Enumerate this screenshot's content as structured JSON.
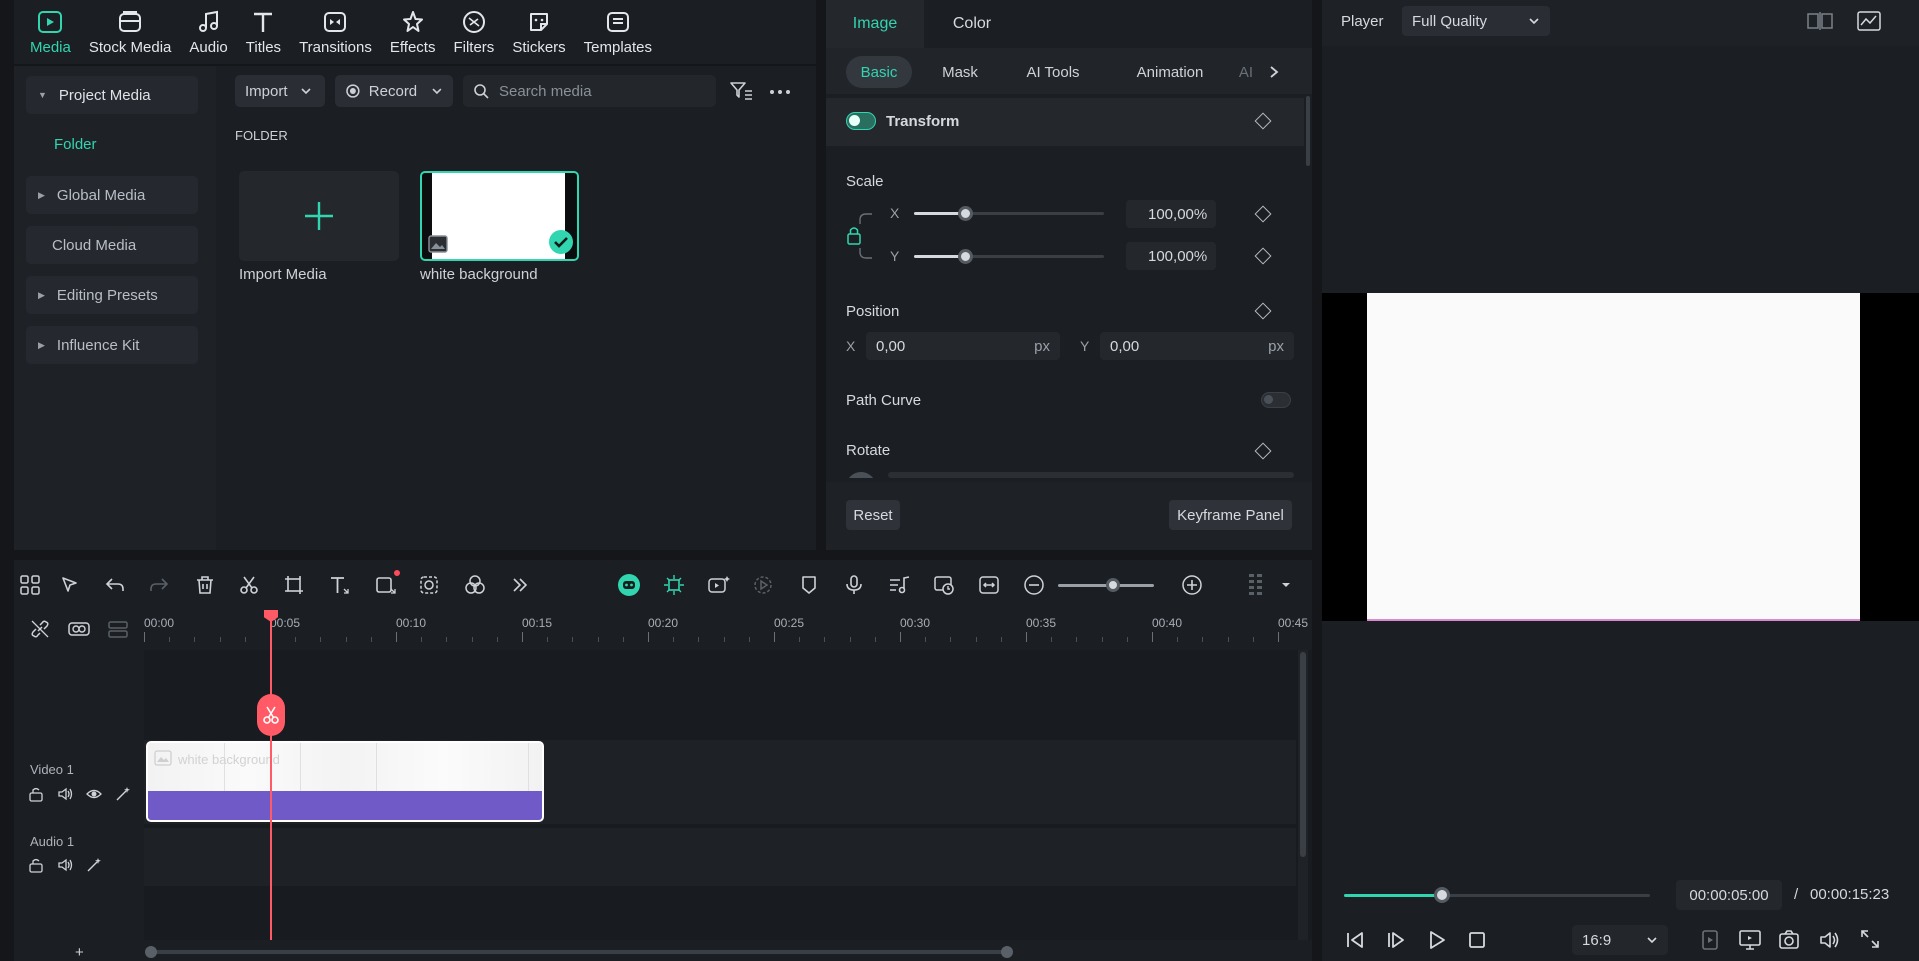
{
  "toolbar": {
    "items": [
      {
        "label": "Media",
        "icon": "media-icon",
        "active": true
      },
      {
        "label": "Stock Media",
        "icon": "stock-media-icon"
      },
      {
        "label": "Audio",
        "icon": "audio-icon"
      },
      {
        "label": "Titles",
        "icon": "titles-icon"
      },
      {
        "label": "Transitions",
        "icon": "transitions-icon"
      },
      {
        "label": "Effects",
        "icon": "effects-icon"
      },
      {
        "label": "Filters",
        "icon": "filters-icon"
      },
      {
        "label": "Stickers",
        "icon": "stickers-icon"
      },
      {
        "label": "Templates",
        "icon": "templates-icon"
      }
    ]
  },
  "sidebar": {
    "project_media": "Project Media",
    "folder": "Folder",
    "global_media": "Global Media",
    "cloud_media": "Cloud Media",
    "editing_presets": "Editing Presets",
    "influence_kit": "Influence Kit"
  },
  "media": {
    "import_label": "Import",
    "record_label": "Record",
    "search_placeholder": "Search media",
    "section_title": "FOLDER",
    "items": [
      {
        "caption": "Import Media"
      },
      {
        "caption": "white background"
      }
    ]
  },
  "properties": {
    "tabs": [
      "Image",
      "Color"
    ],
    "subtabs": [
      "Basic",
      "Mask",
      "AI Tools",
      "Animation",
      "AI"
    ],
    "transform_label": "Transform",
    "scale_label": "Scale",
    "scale_x_label": "X",
    "scale_y_label": "Y",
    "scale_x_value": "100,00",
    "scale_y_value": "100,00",
    "percent_unit": "%",
    "position_label": "Position",
    "pos_x_label": "X",
    "pos_y_label": "Y",
    "pos_x_value": "0,00",
    "pos_y_value": "0,00",
    "px_unit": "px",
    "path_curve_label": "Path Curve",
    "rotate_label": "Rotate",
    "reset_label": "Reset",
    "keyframe_label": "Keyframe Panel"
  },
  "player": {
    "label": "Player",
    "quality": "Full Quality",
    "current_time": "00:00:05:00",
    "separator": "/",
    "total_time": "00:00:15:23",
    "aspect": "16:9",
    "progress": 0.32
  },
  "timeline": {
    "ruler": [
      "00:00",
      "00:05",
      "00:10",
      "00:15",
      "00:20",
      "00:25",
      "00:30",
      "00:35",
      "00:40",
      "00:45"
    ],
    "video_track": "Video 1",
    "audio_track": "Audio 1",
    "clip_label": "white background",
    "add_symbol": "+"
  },
  "colors": {
    "accent": "#31d5b0",
    "playhead": "#ff5a65",
    "clip_purple": "#6f5ac8"
  }
}
